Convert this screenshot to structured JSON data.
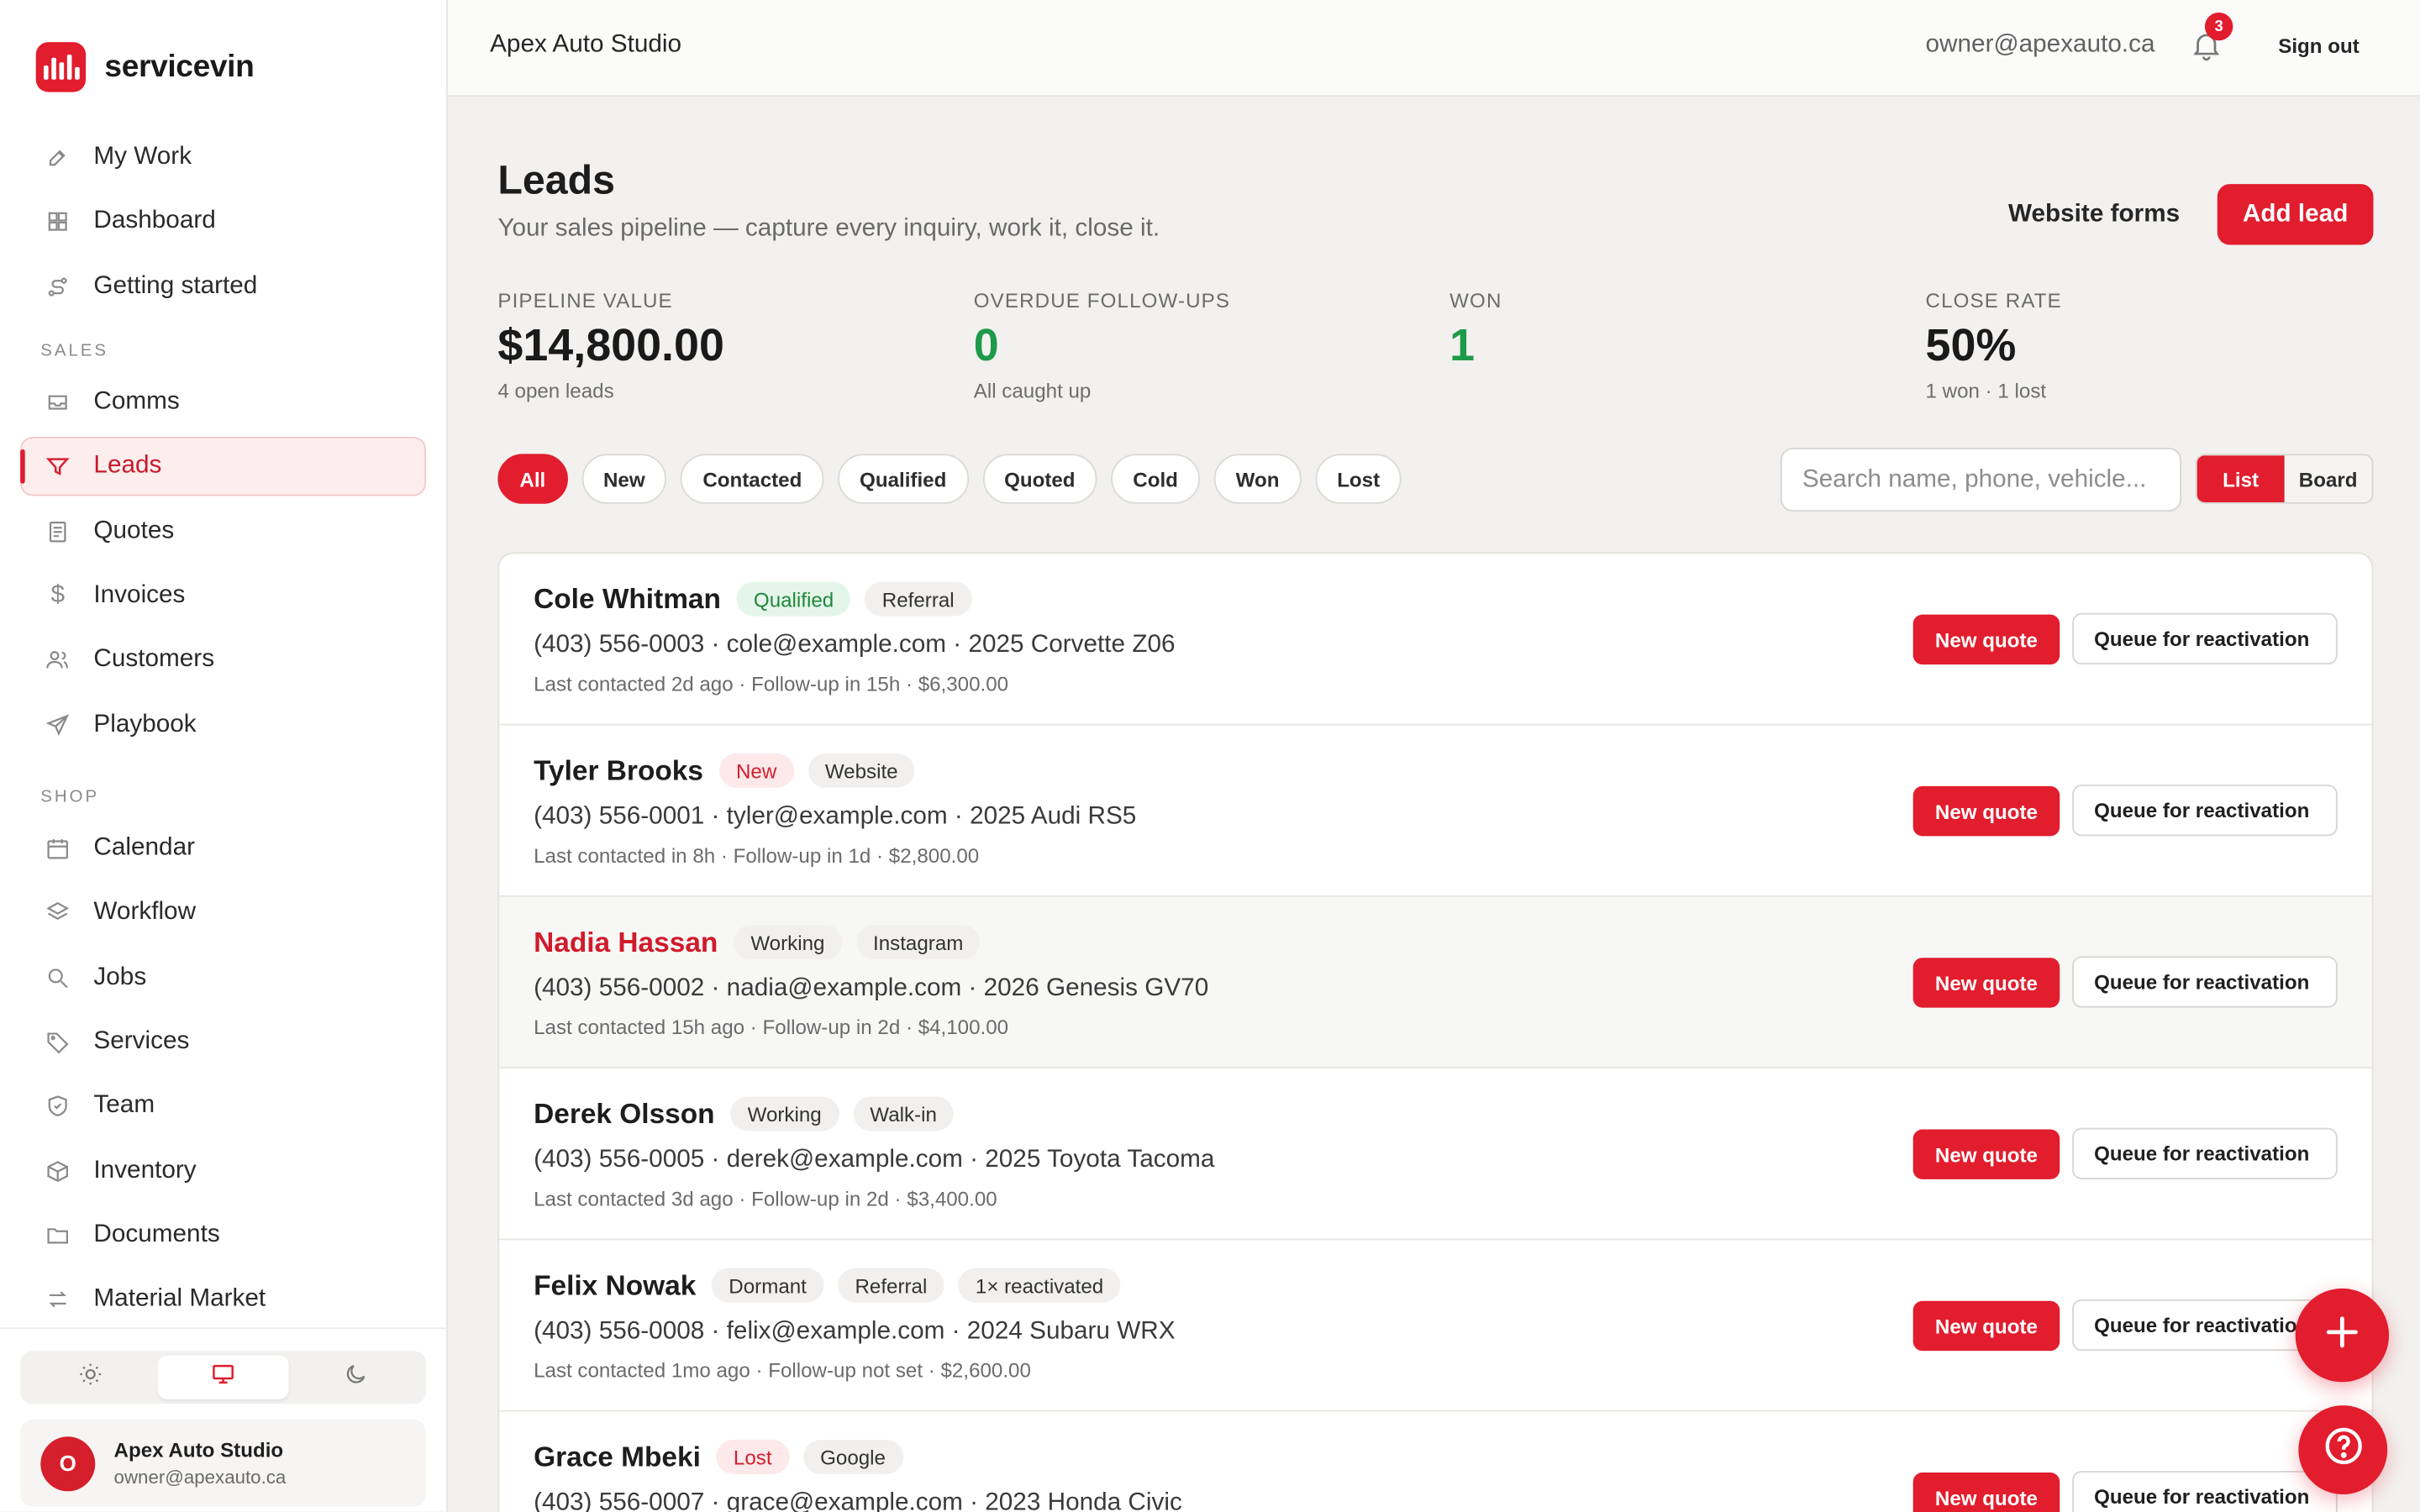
{
  "brand": {
    "name": "servicevin"
  },
  "nav": {
    "items_top": [
      {
        "label": "My Work",
        "icon": "wrench-icon"
      },
      {
        "label": "Dashboard",
        "icon": "grid-icon"
      },
      {
        "label": "Getting started",
        "icon": "route-icon"
      }
    ],
    "sales_label": "SALES",
    "items_sales": [
      {
        "label": "Comms",
        "icon": "inbox-icon"
      },
      {
        "label": "Leads",
        "icon": "funnel-icon",
        "active": true
      },
      {
        "label": "Quotes",
        "icon": "document-icon"
      },
      {
        "label": "Invoices",
        "icon": "dollar-icon"
      },
      {
        "label": "Customers",
        "icon": "users-icon"
      },
      {
        "label": "Playbook",
        "icon": "send-icon"
      }
    ],
    "shop_label": "SHOP",
    "items_shop": [
      {
        "label": "Calendar",
        "icon": "calendar-icon"
      },
      {
        "label": "Workflow",
        "icon": "layers-icon"
      },
      {
        "label": "Jobs",
        "icon": "search-icon"
      },
      {
        "label": "Services",
        "icon": "tag-icon"
      },
      {
        "label": "Team",
        "icon": "shield-icon"
      },
      {
        "label": "Inventory",
        "icon": "box-icon"
      },
      {
        "label": "Documents",
        "icon": "folder-icon"
      },
      {
        "label": "Material Market",
        "icon": "swap-icon"
      }
    ]
  },
  "user": {
    "initial": "O",
    "name": "Apex Auto Studio",
    "email": "owner@apexauto.ca"
  },
  "topbar": {
    "title": "Apex Auto Studio",
    "email": "owner@apexauto.ca",
    "notifications": "3",
    "signout": "Sign out"
  },
  "page": {
    "title": "Leads",
    "subtitle": "Your sales pipeline — capture every inquiry, work it, close it.",
    "website_forms": "Website forms",
    "add_lead": "Add lead"
  },
  "stats": [
    {
      "label": "PIPELINE VALUE",
      "value": "$14,800.00",
      "note": "4 open leads"
    },
    {
      "label": "OVERDUE FOLLOW-UPS",
      "value": "0",
      "note": "All caught up"
    },
    {
      "label": "WON",
      "value": "1",
      "note": ""
    },
    {
      "label": "CLOSE RATE",
      "value": "50%",
      "note": "1 won · 1 lost"
    }
  ],
  "filters": [
    "All",
    "New",
    "Contacted",
    "Qualified",
    "Quoted",
    "Cold",
    "Won",
    "Lost"
  ],
  "search": {
    "placeholder": "Search name, phone, vehicle..."
  },
  "view": {
    "list": "List",
    "board": "Board"
  },
  "lead_actions": {
    "new_quote": "New quote",
    "queue": "Queue for reactivation"
  },
  "leads": [
    {
      "name": "Cole Whitman",
      "tags": [
        "Qualified",
        "Referral"
      ],
      "line": "(403) 556-0003 · cole@example.com · 2025 Corvette Z06",
      "meta": "Last contacted 2d ago · Follow-up in 15h · $6,300.00"
    },
    {
      "name": "Tyler Brooks",
      "tags": [
        "New",
        "Website"
      ],
      "line": "(403) 556-0001 · tyler@example.com · 2025 Audi RS5",
      "meta": "Last contacted in 8h · Follow-up in 1d · $2,800.00"
    },
    {
      "name": "Nadia Hassan",
      "tags": [
        "Working",
        "Instagram"
      ],
      "line": "(403) 556-0002 · nadia@example.com · 2026 Genesis GV70",
      "meta": "Last contacted 15h ago · Follow-up in 2d · $4,100.00"
    },
    {
      "name": "Derek Olsson",
      "tags": [
        "Working",
        "Walk-in"
      ],
      "line": "(403) 556-0005 · derek@example.com · 2025 Toyota Tacoma",
      "meta": "Last contacted 3d ago · Follow-up in 2d · $3,400.00"
    },
    {
      "name": "Felix Nowak",
      "tags": [
        "Dormant",
        "Referral",
        "1× reactivated"
      ],
      "line": "(403) 556-0008 · felix@example.com · 2024 Subaru WRX",
      "meta": "Last contacted 1mo ago · Follow-up not set · $2,600.00"
    },
    {
      "name": "Grace Mbeki",
      "tags": [
        "Lost",
        "Google"
      ],
      "line": "(403) 556-0007 · grace@example.com · 2023 Honda Civic",
      "meta": ""
    }
  ],
  "colors": {
    "accent": "#e11d2e",
    "success": "#1e9a49"
  }
}
